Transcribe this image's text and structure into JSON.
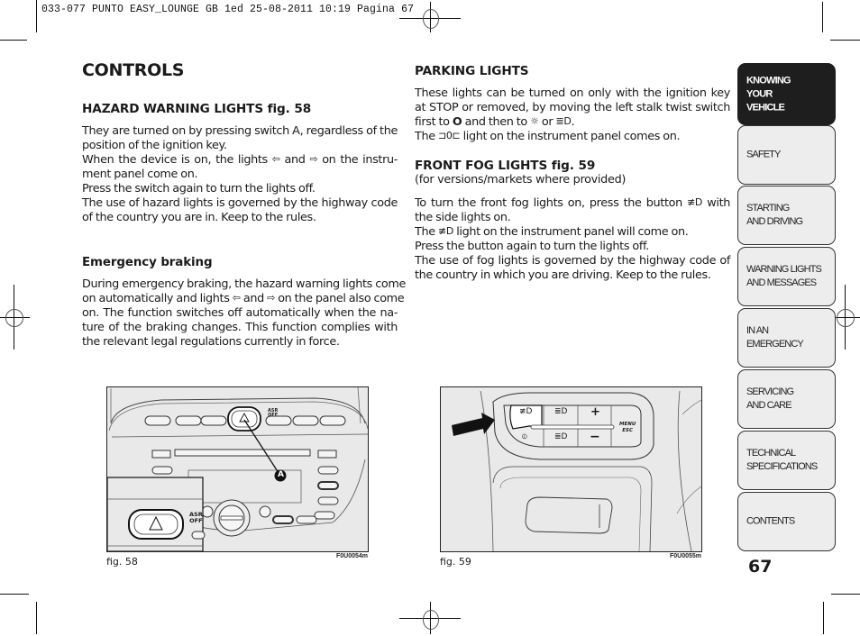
{
  "print_header": "033-077 PUNTO EASY_LOUNGE GB 1ed  25-08-2011  10:19  Pagina 67",
  "page_title": "CONTROLS",
  "left_column": {
    "hazard": {
      "heading": "HAZARD WARNING LIGHTS fig. 58",
      "lines": [
        "They are turned on by pressing switch A, regardless of the",
        "position of the ignition key.",
        "When the device is on, the lights",
        "and",
        "on the instru-",
        "ment panel come on.",
        "Press the switch again to turn the lights off.",
        "The use of hazard lights is governed by the highway code",
        "of the country you are in. Keep to the rules."
      ]
    },
    "emergency": {
      "heading": "Emergency braking",
      "lines": [
        "During emergency braking, the hazard warning lights come",
        "on automatically and lights",
        "and",
        "on the panel also come",
        "on. The function switches off automatically when the na-",
        "ture of the braking changes. This function complies with",
        "the relevant legal regulations currently in force."
      ]
    }
  },
  "right_column": {
    "parking": {
      "heading": "PARKING LIGHTS",
      "lines": [
        "These lights can be turned on only with the ignition key",
        "at STOP or removed, by moving the left stalk twist switch",
        "first to",
        "O",
        "and then to",
        "or",
        ".",
        "The",
        "light on the instrument panel comes on."
      ]
    },
    "fog": {
      "heading": "FRONT FOG LIGHTS fig. 59",
      "subheading": "(for versions/markets where provided)",
      "lines": [
        "To turn the front fog lights on, press the button",
        "with",
        "the side lights on.",
        "The",
        "light on the instrument panel will come on.",
        "Press the button again to turn the lights off.",
        "The use of fog lights is governed by the highway code of",
        "the country in which you are driving.  Keep to the rules."
      ]
    }
  },
  "icons": {
    "arrow_left": "⇦",
    "arrow_right": "⇨",
    "sun": "☼",
    "headlight": "≣D",
    "parking_lamp": "⊐0⊏",
    "fog_light": "≢D"
  },
  "figures": {
    "fig58": {
      "caption": "fig. 58",
      "code": "F0U0054m",
      "callout": "A",
      "asr_label_1": "ASR",
      "asr_label_2": "OFF"
    },
    "fig59": {
      "caption": "fig. 59",
      "code": "F0U0055m",
      "plus": "+",
      "minus": "−",
      "menu_1": "MENU",
      "menu_2": "ESC"
    }
  },
  "sidebar": {
    "tabs": [
      {
        "label": "KNOWING\nYOUR\nVEHICLE",
        "active": true
      },
      {
        "label": "SAFETY",
        "active": false
      },
      {
        "label": "STARTING\nAND DRIVING",
        "active": false
      },
      {
        "label": "WARNING LIGHTS\nAND MESSAGES",
        "active": false
      },
      {
        "label": "IN AN\nEMERGENCY",
        "active": false
      },
      {
        "label": "SERVICING\nAND CARE",
        "active": false
      },
      {
        "label": "TECHNICAL\nSPECIFICATIONS",
        "active": false
      },
      {
        "label": "CONTENTS",
        "active": false
      }
    ]
  },
  "page_number": "67"
}
